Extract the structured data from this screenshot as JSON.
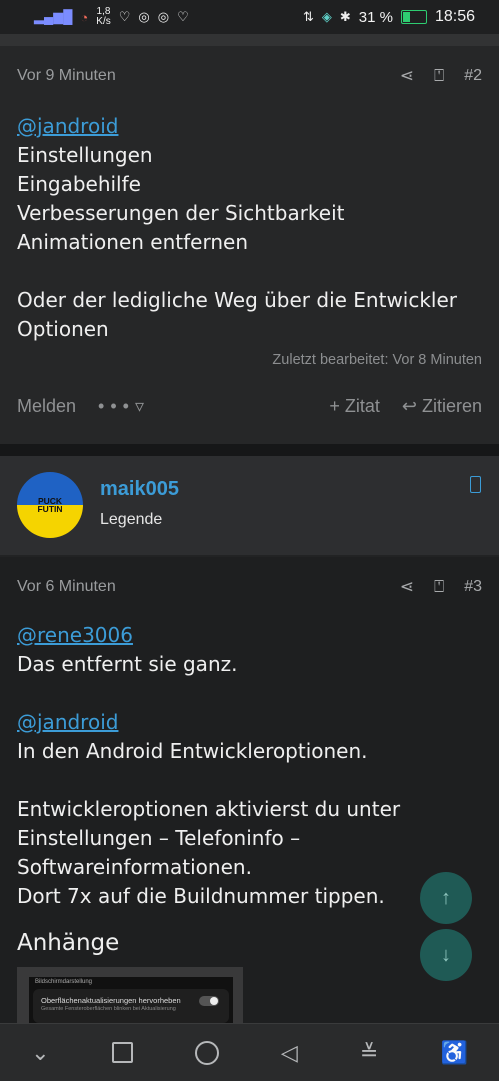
{
  "status_bar": {
    "speed": "1,8",
    "speed_unit": "K/s",
    "battery_percent": "31 %",
    "battery_level": 0.31,
    "time": "18:56",
    "icons": [
      "signal-icon",
      "wifi-icon",
      "heart-icon",
      "chrome-icon",
      "chrome-icon",
      "health-icon",
      "data-icon",
      "vibrate-icon",
      "bluetooth-icon",
      "battery-icon"
    ]
  },
  "post1": {
    "time": "Vor 9 Minuten",
    "number": "#2",
    "mention": "@jandroid",
    "lines": [
      "Einstellungen",
      "Eingabehilfe",
      "Verbesserungen der Sichtbarkeit",
      "Animationen entfernen"
    ],
    "paragraph2_line1": "Oder der ledigliche Weg über die Entwickler",
    "paragraph2_line2": "Optionen",
    "edited": "Zuletzt bearbeitet: Vor 8 Minuten",
    "report": "Melden",
    "quote_add": "+ Zitat",
    "reply": "Zitieren"
  },
  "user": {
    "avatar_text_line1": "PUCK",
    "avatar_text_line2": "FUTIN",
    "name": "maik005",
    "role": "Legende"
  },
  "post2": {
    "time": "Vor 6 Minuten",
    "number": "#3",
    "mention1": "@rene3006",
    "line1": "Das entfernt sie ganz.",
    "mention2": "@jandroid",
    "line2": "In den Android Entwickleroptionen.",
    "line3": "Entwickleroptionen aktivierst du unter",
    "line4": "Einstellungen – Telefoninfo –",
    "line5": "Softwareinformationen.",
    "line6": "Dort 7x auf die Buildnummer tippen.",
    "attachments_heading": "Anhänge",
    "thumb_title": "Bildschirmdarstellung",
    "thumb_setting": "Oberflächenaktualisierungen hervorheben",
    "thumb_setting_sub": "Gesamte Fensteroberflächen blinken bei Aktualisierung"
  },
  "fab": {
    "up_icon": "↑",
    "down_icon": "↓"
  },
  "nav": {
    "chevron": "⌄",
    "back": "◁",
    "menu": "≚",
    "accessibility": "♿"
  }
}
